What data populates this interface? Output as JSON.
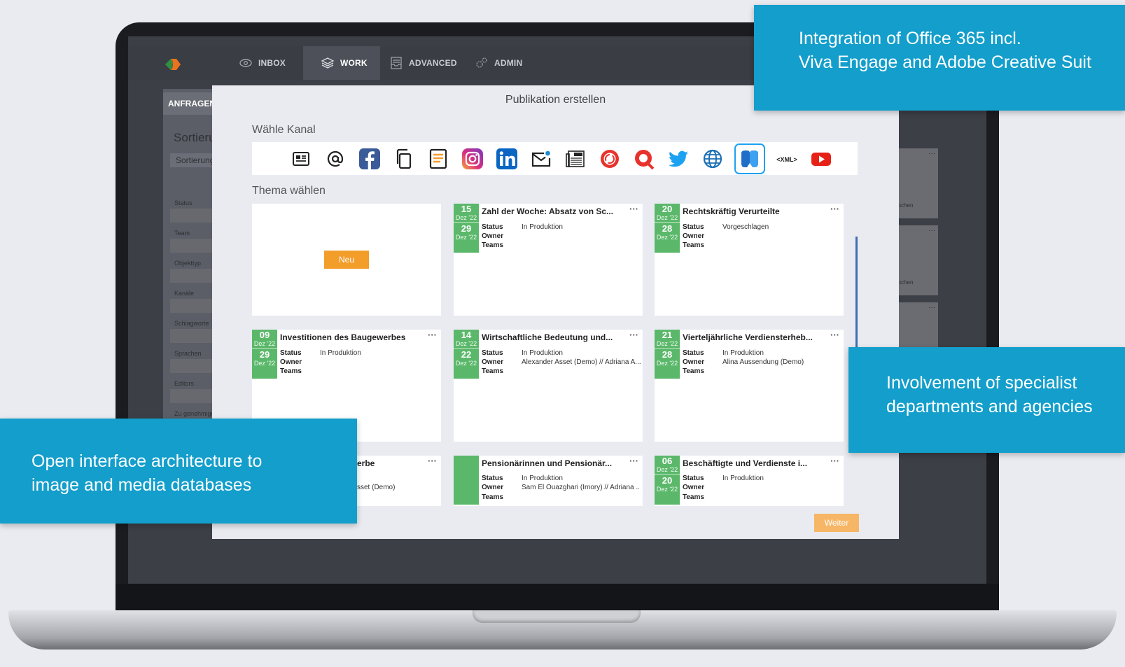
{
  "nav": {
    "inbox": "INBOX",
    "work": "WORK",
    "advanced": "ADVANCED",
    "admin": "ADMIN"
  },
  "sidebar": {
    "header": "ANFRAGEN",
    "heading": "Sortieru",
    "sort_label": "Sortierung",
    "filters": [
      "Status",
      "Team",
      "Objekttyp",
      "Kanäle",
      "Schlagworte",
      "Sprachen",
      "Editors",
      "Zu genehmige"
    ]
  },
  "right_panel": {
    "labels": [
      "rochen",
      "rochen"
    ]
  },
  "modal": {
    "title": "Publikation erstellen",
    "channel_label": "Wähle Kanal",
    "theme_label": "Thema wählen",
    "new_button": "Neu",
    "next_button": "Weiter",
    "channels": [
      "newsletter-icon",
      "email-at-icon",
      "facebook-icon",
      "copy-icon",
      "document-icon",
      "instagram-icon",
      "linkedin-icon",
      "mail-notification-icon",
      "press-icon",
      "red-circle-icon",
      "red-pin-icon",
      "twitter-icon",
      "globe-icon",
      "viva-engage-icon",
      "xml-icon",
      "youtube-icon"
    ],
    "field_labels": {
      "status": "Status",
      "owner": "Owner",
      "teams": "Teams"
    },
    "cards": [
      {
        "title": "Zahl der Woche: Absatz von Sc...",
        "start_day": "15",
        "start_month": "Dez '22",
        "end_day": "29",
        "end_month": "Dez '22",
        "status": "In Produktion",
        "owner": ""
      },
      {
        "title": "Rechtskräftig Verurteilte",
        "start_day": "20",
        "start_month": "Dez '22",
        "end_day": "28",
        "end_month": "Dez '22",
        "status": "Vorgeschlagen",
        "owner": ""
      },
      {
        "title": "Investitionen des Baugewerbes",
        "start_day": "09",
        "start_month": "Dez '22",
        "end_day": "29",
        "end_month": "Dez '22",
        "status": "In Produktion",
        "owner": ""
      },
      {
        "title": "Wirtschaftliche Bedeutung und...",
        "start_day": "14",
        "start_month": "Dez '22",
        "end_day": "22",
        "end_month": "Dez '22",
        "status": "In Produktion",
        "owner": "Alexander Asset (Demo) // Adriana A..."
      },
      {
        "title": "Vierteljährliche Verdiensterheb...",
        "start_day": "21",
        "start_month": "Dez '22",
        "end_day": "28",
        "end_month": "Dez '22",
        "status": "In Produktion",
        "owner": "Alina Aussendung (Demo)"
      },
      {
        "title": "erbe",
        "owner_partial": "sset (Demo)"
      },
      {
        "title": "Pensionärinnen und Pensionär...",
        "start_day": "",
        "start_month": "",
        "end_day": "",
        "end_month": "",
        "status": "In Produktion",
        "owner": "Sam El Ouazghari (Imory) // Adriana ..."
      },
      {
        "title": "Beschäftigte und Verdienste i...",
        "start_day": "06",
        "start_month": "Dez '22",
        "end_day": "20",
        "end_month": "Dez '22",
        "status": "In Produktion",
        "owner": ""
      }
    ]
  },
  "callouts": {
    "office": [
      "Integration of Office 365 incl.",
      "Viva Engage and Adobe Creative Suit"
    ],
    "departments": [
      "Involvement of specialist",
      "departments and agencies"
    ],
    "interface": [
      "Open interface architecture to",
      "image and media databases"
    ]
  },
  "colors": {
    "accent_blue": "#139ecb",
    "date_green": "#5bb86a",
    "button_orange": "#f39d2b"
  }
}
